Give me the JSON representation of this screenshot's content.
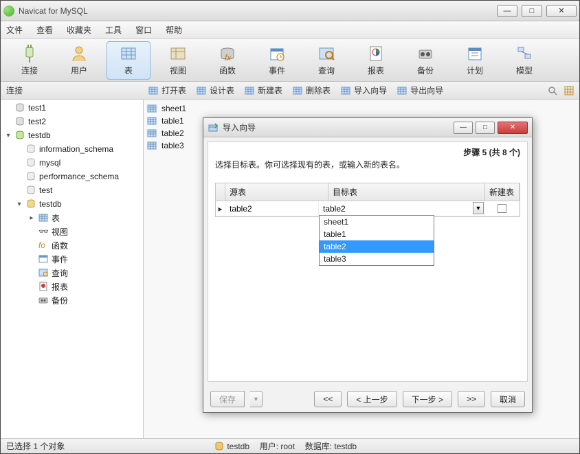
{
  "app": {
    "title": "Navicat for MySQL"
  },
  "menu": [
    "文件",
    "查看",
    "收藏夹",
    "工具",
    "窗口",
    "帮助"
  ],
  "toolbar": [
    {
      "label": "连接",
      "icon": "plug"
    },
    {
      "label": "用户",
      "icon": "user"
    },
    {
      "label": "表",
      "icon": "table",
      "active": true
    },
    {
      "label": "视图",
      "icon": "view"
    },
    {
      "label": "函数",
      "icon": "func"
    },
    {
      "label": "事件",
      "icon": "event"
    },
    {
      "label": "查询",
      "icon": "query"
    },
    {
      "label": "报表",
      "icon": "report"
    },
    {
      "label": "备份",
      "icon": "backup"
    },
    {
      "label": "计划",
      "icon": "plan"
    },
    {
      "label": "模型",
      "icon": "model"
    }
  ],
  "subbar": {
    "left": "连接",
    "actions": [
      "打开表",
      "设计表",
      "新建表",
      "删除表",
      "导入向导",
      "导出向导"
    ]
  },
  "tree": {
    "items": [
      {
        "label": "test1",
        "icon": "db",
        "indent": 0,
        "caret": ""
      },
      {
        "label": "test2",
        "icon": "db",
        "indent": 0,
        "caret": ""
      },
      {
        "label": "testdb",
        "icon": "db-open",
        "indent": 0,
        "caret": "▾"
      },
      {
        "label": "information_schema",
        "icon": "schema",
        "indent": 1,
        "caret": ""
      },
      {
        "label": "mysql",
        "icon": "schema",
        "indent": 1,
        "caret": ""
      },
      {
        "label": "performance_schema",
        "icon": "schema",
        "indent": 1,
        "caret": ""
      },
      {
        "label": "test",
        "icon": "schema",
        "indent": 1,
        "caret": ""
      },
      {
        "label": "testdb",
        "icon": "schema-open",
        "indent": 1,
        "caret": "▾"
      },
      {
        "label": "表",
        "icon": "table",
        "indent": 2,
        "caret": "▸"
      },
      {
        "label": "视图",
        "icon": "view",
        "indent": 2,
        "caret": ""
      },
      {
        "label": "函数",
        "icon": "func",
        "indent": 2,
        "caret": ""
      },
      {
        "label": "事件",
        "icon": "event",
        "indent": 2,
        "caret": ""
      },
      {
        "label": "查询",
        "icon": "query",
        "indent": 2,
        "caret": ""
      },
      {
        "label": "报表",
        "icon": "report",
        "indent": 2,
        "caret": ""
      },
      {
        "label": "备份",
        "icon": "backup",
        "indent": 2,
        "caret": ""
      }
    ]
  },
  "tables": [
    "sheet1",
    "table1",
    "table2",
    "table3"
  ],
  "status": {
    "left": "已选择 1 个对象",
    "conn": "testdb",
    "user_label": "用户: root",
    "db_label": "数据库: testdb"
  },
  "dialog": {
    "title": "导入向导",
    "step": "步骤 5 (共 8 个)",
    "instruction": "选择目标表。你可选择现有的表，或输入新的表名。",
    "columns": {
      "src": "源表",
      "tgt": "目标表",
      "new": "新建表"
    },
    "row": {
      "src": "table2",
      "tgt": "table2"
    },
    "options": [
      "sheet1",
      "table1",
      "table2",
      "table3"
    ],
    "selected_option": "table2",
    "buttons": {
      "save": "保存",
      "first": "<<",
      "prev": "< 上一步",
      "next": "下一步 >",
      "last": ">>",
      "cancel": "取消"
    }
  }
}
